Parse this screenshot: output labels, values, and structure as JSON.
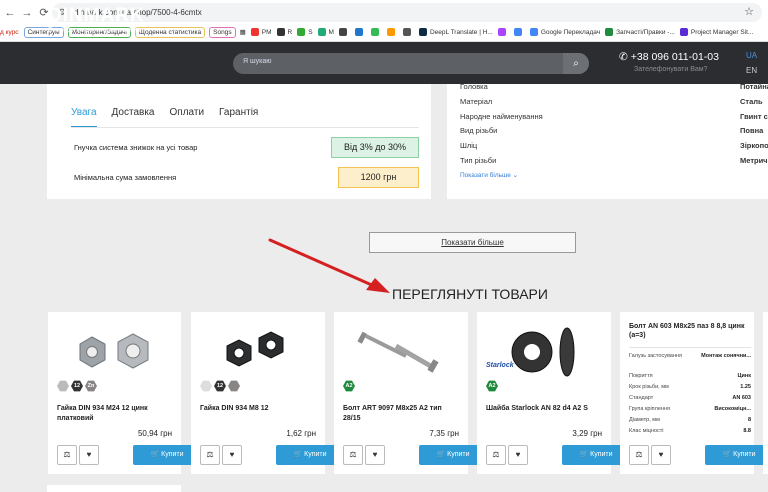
{
  "browser": {
    "url": "dinmark.com.ua/shop/7500-4-6cmtx",
    "bookmarks": [
      "д курс",
      "Синтегрум",
      "Моніторинг/Задачі",
      "Щоденна статистика",
      "Songs",
      "PM",
      "R",
      "S",
      "M",
      "DeepL Translate | Н...",
      "Google Перекладач",
      "Запчасті/Правки -...",
      "Project Manager Sit..."
    ]
  },
  "header": {
    "logo": "DINMARK",
    "tagline": "Експерт з якісного кріплення",
    "search_placeholder": "Я шукаю",
    "phone": "+38 096 011-01-03",
    "callback": "Зателефонувати Вам?",
    "lang_active": "UA",
    "lang_other": "EN"
  },
  "info": {
    "tabs": [
      "Увага",
      "Доставка",
      "Оплати",
      "Гарантія"
    ],
    "row1_label": "Гнучка система знижок на усі товар",
    "row1_badge": "Від 3% до 30%",
    "row2_label": "Мінімальна сума замовлення",
    "row2_badge": "1200 грн"
  },
  "specs": {
    "rows": [
      {
        "label": "Головка",
        "value": "Потайна"
      },
      {
        "label": "Матеріал",
        "value": "Сталь"
      },
      {
        "label": "Народне найменування",
        "value": "Гвинт само"
      },
      {
        "label": "Вид різьби",
        "value": "Повна"
      },
      {
        "label": "Шліц",
        "value": "Зіркоподіб"
      },
      {
        "label": "Тип різьби",
        "value": "Метрична"
      }
    ],
    "show_more": "Показати більше"
  },
  "show_more_button": "Показати більше",
  "section_title": "ПЕРЕГЛЯНУТІ ТОВАРИ",
  "buy_label": "Купити",
  "products": [
    {
      "name": "Гайка DIN 934 M24 12 цинк платковий",
      "price": "50,94 грн",
      "tags": [
        "",
        "12",
        "Zn"
      ]
    },
    {
      "name": "Гайка DIN 934 M8 12",
      "price": "1,62 грн",
      "tags": [
        "",
        "12",
        ""
      ]
    },
    {
      "name": "Болт ART 9097 M8x25 A2 тип 28/15",
      "price": "7,35 грн",
      "tags": [
        "A2"
      ]
    },
    {
      "name": "Шайба Starlock AN 82 d4 A2 S",
      "price": "3,29 грн",
      "tags": [
        "A2"
      ],
      "brand": "Starlock"
    }
  ],
  "detail_card": {
    "name": "Болт AN 603 M8x25 паз 8 8,8 цинк (а=3)",
    "rows": [
      {
        "label": "Галузь застосування",
        "value": "Монтаж сонячни..."
      },
      {
        "label": "Покриття",
        "value": "Цинк"
      },
      {
        "label": "Крок різьби, мм",
        "value": "1.25"
      },
      {
        "label": "Стандарт",
        "value": "AN 603"
      },
      {
        "label": "Група кріплення",
        "value": "Високоміцн..."
      },
      {
        "label": "Діаметр, мм",
        "value": "8"
      },
      {
        "label": "Клас міцності",
        "value": "8.8"
      }
    ]
  },
  "colors": {
    "accent": "#2f9bd6",
    "header_bg": "#2b2d30",
    "arrow": "#d42020"
  }
}
